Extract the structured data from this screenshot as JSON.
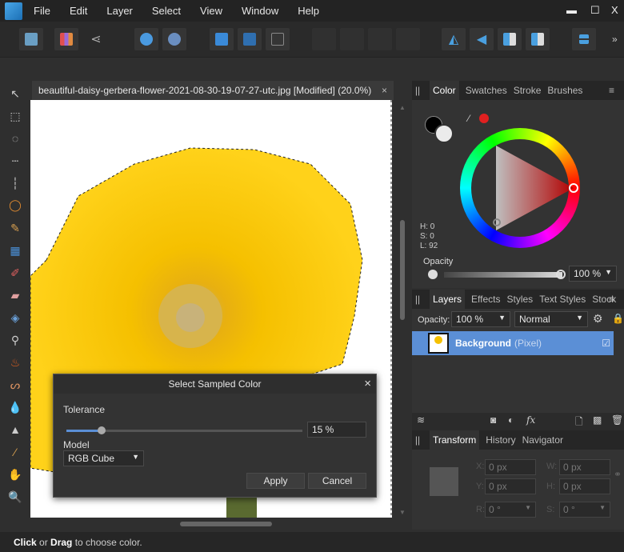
{
  "menu": {
    "items": [
      "File",
      "Edit",
      "Layer",
      "Select",
      "View",
      "Window",
      "Help"
    ],
    "minimize": "▬",
    "maximize": "☐",
    "close": "X"
  },
  "toolbar": {
    "more": "»"
  },
  "document": {
    "tab_title": "beautiful-daisy-gerbera-flower-2021-08-30-19-07-27-utc.jpg [Modified] (20.0%)",
    "close": "×"
  },
  "color_panel": {
    "tabs": [
      "Color",
      "Swatches",
      "Stroke",
      "Brushes"
    ],
    "h": "H: 0",
    "s": "S: 0",
    "l": "L: 92",
    "opacity_label": "Opacity",
    "opacity_value": "100 %",
    "accent": "#e02020"
  },
  "layers_panel": {
    "tabs": [
      "Layers",
      "Effects",
      "Styles",
      "Text Styles",
      "Stock"
    ],
    "opacity_label": "Opacity:",
    "opacity_value": "100 %",
    "blend_mode": "Normal",
    "layer_name": "Background",
    "layer_type": "(Pixel)",
    "selected_color": "#5b8fd6"
  },
  "transform_panel": {
    "tabs": [
      "Transform",
      "History",
      "Navigator"
    ],
    "x_label": "X:",
    "y_label": "Y:",
    "w_label": "W:",
    "h_label": "H:",
    "r_label": "R:",
    "s_label": "S:",
    "x": "0 px",
    "y": "0 px",
    "w": "0 px",
    "h": "0 px",
    "r": "0 °",
    "s": "0 °"
  },
  "dialog": {
    "title": "Select Sampled Color",
    "close": "×",
    "tolerance_label": "Tolerance",
    "tolerance_value": "15 %",
    "tolerance_percent": 15,
    "model_label": "Model",
    "model_value": "RGB Cube",
    "apply": "Apply",
    "cancel": "Cancel"
  },
  "status": {
    "click": "Click",
    "or": " or ",
    "drag": "Drag",
    "rest": " to choose color."
  }
}
